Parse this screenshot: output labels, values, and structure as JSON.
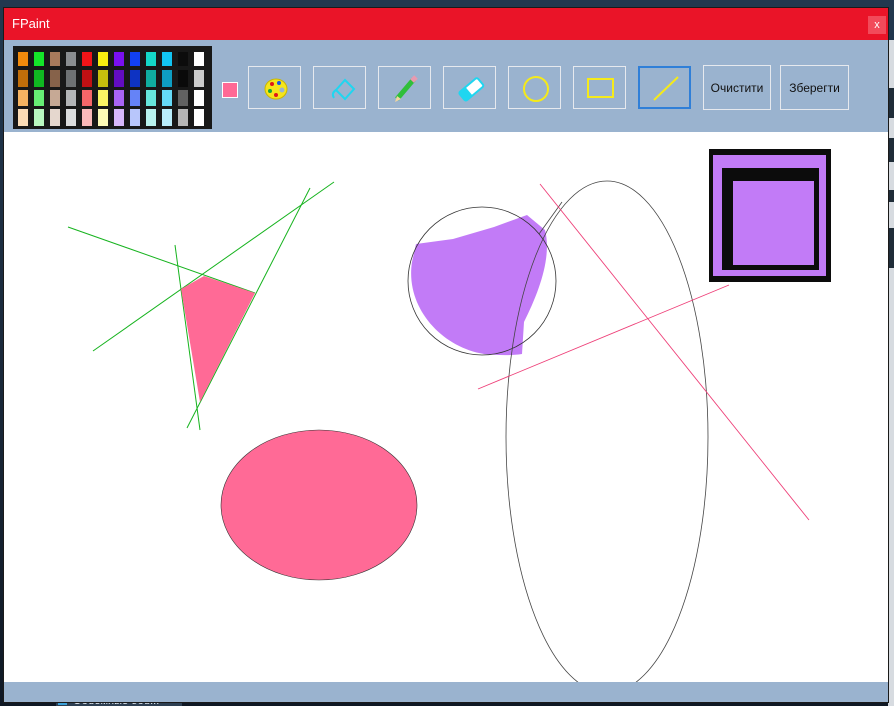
{
  "window": {
    "title": "FPaint",
    "close_label": "x"
  },
  "toolbar": {
    "palette": {
      "base_colors": [
        "#f08a0c",
        "#14e629",
        "#a87a5c",
        "#8a8d90",
        "#f01418",
        "#f7ee10",
        "#7a10f0",
        "#1240f2",
        "#14d8c8",
        "#12c4f2",
        "#0c0c0c",
        "#ffffff"
      ]
    },
    "current_color": "#ff6a96",
    "tools": [
      {
        "name": "palette-tool",
        "icon": "palette-icon"
      },
      {
        "name": "fill-tool",
        "icon": "paint-bucket-icon"
      },
      {
        "name": "pencil-tool",
        "icon": "pencil-icon"
      },
      {
        "name": "eraser-tool",
        "icon": "eraser-icon"
      },
      {
        "name": "ellipse-tool",
        "icon": "circle-icon"
      },
      {
        "name": "rectangle-tool",
        "icon": "rectangle-icon"
      },
      {
        "name": "line-tool",
        "icon": "line-icon",
        "selected": true
      }
    ],
    "clear_label": "Очистити",
    "save_label": "Зберегти"
  },
  "desktop": {
    "taskbar_label": "Объемные объ..."
  }
}
